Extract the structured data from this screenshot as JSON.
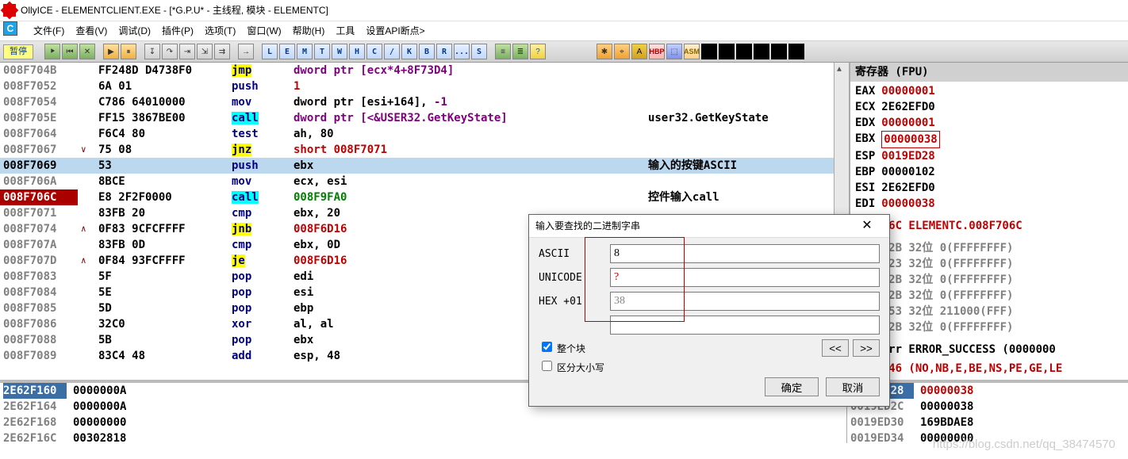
{
  "title": "OllyICE - ELEMENTCLIENT.EXE - [*G.P.U* -  主线程, 模块 - ELEMENTC]",
  "menu": {
    "file": "文件(F)",
    "view": "查看(V)",
    "debug": "调试(D)",
    "plugins": "插件(P)",
    "options": "选项(T)",
    "window": "窗口(W)",
    "help": "帮助(H)",
    "tools": "工具",
    "api": "设置API断点>"
  },
  "status": "暂停",
  "letter_buttons": [
    "L",
    "E",
    "M",
    "T",
    "W",
    "H",
    "C",
    "/",
    "K",
    "B",
    "R",
    "...",
    "S"
  ],
  "disasm": [
    {
      "addr": "008F704B",
      "bytes": "FF248D D4738F0",
      "mnem": "jmp",
      "mnemcls": "hl-yellow",
      "ops": "dword ptr [ecx*4+8F73D4]",
      "opscls": "op-purple"
    },
    {
      "addr": "008F7052",
      "bytes": "6A 01",
      "mnem": "push",
      "ops": "1",
      "opscls": "op-red"
    },
    {
      "addr": "008F7054",
      "bytes": "C786 64010000",
      "mnem": "mov",
      "ops": "dword ptr [esi+164], -1",
      "opscls": "op-purple"
    },
    {
      "addr": "008F705E",
      "bytes": "FF15 3867BE00",
      "mnem": "call",
      "mnemcls": "hl-cyan",
      "ops": "dword ptr [<&USER32.GetKeyState]",
      "opscls": "op-purple",
      "cmt": "user32.GetKeyState"
    },
    {
      "addr": "008F7064",
      "bytes": "F6C4 80",
      "mnem": "test",
      "ops": "ah, 80",
      "opscls": ""
    },
    {
      "addr": "008F7067",
      "bytes": "75 08",
      "mnem": "jnz",
      "mnemcls": "hl-yellow",
      "ops": "short 008F7071",
      "opscls": "op-red",
      "mk": "∨"
    },
    {
      "addr": "008F7069",
      "bytes": "53",
      "mnem": "push",
      "ops": "ebx",
      "sel": true,
      "cmt": "输入的按键ASCII"
    },
    {
      "addr": "008F706A",
      "bytes": "8BCE",
      "mnem": "mov",
      "ops": "ecx, esi"
    },
    {
      "addr": "008F706C",
      "addrcls": "hl-addr-red",
      "bytes": "E8 2F2F0000",
      "mnem": "call",
      "mnemcls": "hl-cyan",
      "ops": "008F9FA0",
      "opscls": "op-green",
      "cmt": "控件输入call"
    },
    {
      "addr": "008F7071",
      "bytes": "83FB 20",
      "mnem": "cmp",
      "ops": "ebx, 20",
      "opscls": ""
    },
    {
      "addr": "008F7074",
      "bytes": "0F83 9CFCFFFF",
      "mnem": "jnb",
      "mnemcls": "hl-yellow",
      "ops": "008F6D16",
      "opscls": "op-red",
      "mk": "∧"
    },
    {
      "addr": "008F707A",
      "bytes": "83FB 0D",
      "mnem": "cmp",
      "ops": "ebx, 0D",
      "opscls": ""
    },
    {
      "addr": "008F707D",
      "bytes": "0F84 93FCFFFF",
      "mnem": "je",
      "mnemcls": "hl-yellow",
      "ops": "008F6D16",
      "opscls": "op-red",
      "mk": "∧"
    },
    {
      "addr": "008F7083",
      "bytes": "5F",
      "mnem": "pop",
      "ops": "edi"
    },
    {
      "addr": "008F7084",
      "bytes": "5E",
      "mnem": "pop",
      "ops": "esi"
    },
    {
      "addr": "008F7085",
      "bytes": "5D",
      "mnem": "pop",
      "ops": "ebp"
    },
    {
      "addr": "008F7086",
      "bytes": "32C0",
      "mnem": "xor",
      "ops": "al, al"
    },
    {
      "addr": "008F7088",
      "bytes": "5B",
      "mnem": "pop",
      "ops": "ebx"
    },
    {
      "addr": "008F7089",
      "bytes": "83C4 48",
      "mnem": "add",
      "ops": "esp, 48",
      "opscls": ""
    }
  ],
  "registers_title": "寄存器 (FPU)",
  "registers": [
    {
      "n": "EAX",
      "v": "00000001",
      "c": "rval-red"
    },
    {
      "n": "ECX",
      "v": "2E62EFD0",
      "c": "rval-black"
    },
    {
      "n": "EDX",
      "v": "00000001",
      "c": "rval-red"
    },
    {
      "n": "EBX",
      "v": "00000038",
      "c": "rval-red",
      "hl": true
    },
    {
      "n": "ESP",
      "v": "0019ED28",
      "c": "rval-red"
    },
    {
      "n": "EBP",
      "v": "00000102",
      "c": "rval-black"
    },
    {
      "n": "ESI",
      "v": "2E62EFD0",
      "c": "rval-black"
    },
    {
      "n": "EDI",
      "v": "00000038",
      "c": "rval-red"
    }
  ],
  "eip_line": "08F706C ELEMENTC.008F706C",
  "segments": [
    "ES 002B 32位 0(FFFFFFFF)",
    "CS 0023 32位 0(FFFFFFFF)",
    "SS 002B 32位 0(FFFFFFFF)",
    "DS 002B 32位 0(FFFFFFFF)",
    "FS 0053 32位 211000(FFF)",
    "GS 002B 32位 0(FFFFFFFF)"
  ],
  "lasterr": "LastErr ERROR_SUCCESS (0000000",
  "eflags": "0200246 (NO,NB,E,BE,NS,PE,GE,LE",
  "dump": [
    {
      "a": "2E62F160",
      "v": "0000000A",
      "sel": true
    },
    {
      "a": "2E62F164",
      "v": "0000000A"
    },
    {
      "a": "2E62F168",
      "v": "00000000"
    },
    {
      "a": "2E62F16C",
      "v": "00302818"
    }
  ],
  "stack": [
    {
      "a": "0019ED28",
      "v": "00000038",
      "sel": true,
      "vc": "red"
    },
    {
      "a": "0019ED2C",
      "v": "00000038"
    },
    {
      "a": "0019ED30",
      "v": "169BDAE8"
    },
    {
      "a": "0019ED34",
      "v": "00000000"
    }
  ],
  "dialog": {
    "title": "输入要查找的二进制字串",
    "ascii_label": "ASCII",
    "ascii_value": "8",
    "unicode_label": "UNICODE",
    "unicode_value": "?",
    "hex_label": "HEX +01",
    "hex_value": "38",
    "chk_block": "整个块",
    "chk_block_checked": true,
    "chk_case": "区分大小写",
    "chk_case_checked": false,
    "prev": "<<",
    "next": ">>",
    "ok": "确定",
    "cancel": "取消"
  },
  "watermark": "https://blog.csdn.net/qq_38474570"
}
